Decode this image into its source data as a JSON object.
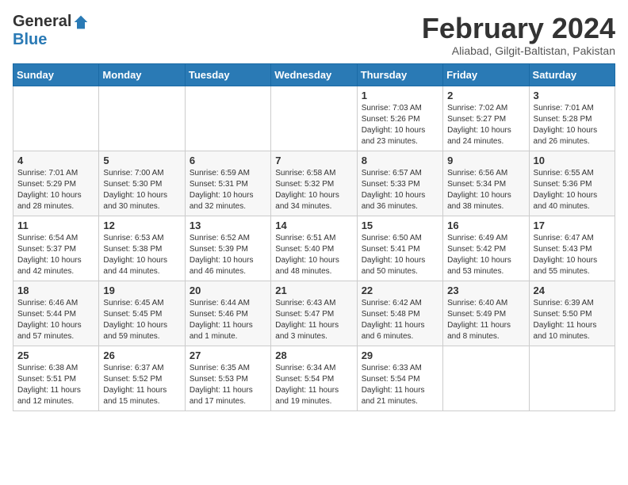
{
  "header": {
    "logo_general": "General",
    "logo_blue": "Blue",
    "month_year": "February 2024",
    "location": "Aliabad, Gilgit-Baltistan, Pakistan"
  },
  "days_of_week": [
    "Sunday",
    "Monday",
    "Tuesday",
    "Wednesday",
    "Thursday",
    "Friday",
    "Saturday"
  ],
  "weeks": [
    [
      {
        "day": "",
        "info": ""
      },
      {
        "day": "",
        "info": ""
      },
      {
        "day": "",
        "info": ""
      },
      {
        "day": "",
        "info": ""
      },
      {
        "day": "1",
        "info": "Sunrise: 7:03 AM\nSunset: 5:26 PM\nDaylight: 10 hours and 23 minutes."
      },
      {
        "day": "2",
        "info": "Sunrise: 7:02 AM\nSunset: 5:27 PM\nDaylight: 10 hours and 24 minutes."
      },
      {
        "day": "3",
        "info": "Sunrise: 7:01 AM\nSunset: 5:28 PM\nDaylight: 10 hours and 26 minutes."
      }
    ],
    [
      {
        "day": "4",
        "info": "Sunrise: 7:01 AM\nSunset: 5:29 PM\nDaylight: 10 hours and 28 minutes."
      },
      {
        "day": "5",
        "info": "Sunrise: 7:00 AM\nSunset: 5:30 PM\nDaylight: 10 hours and 30 minutes."
      },
      {
        "day": "6",
        "info": "Sunrise: 6:59 AM\nSunset: 5:31 PM\nDaylight: 10 hours and 32 minutes."
      },
      {
        "day": "7",
        "info": "Sunrise: 6:58 AM\nSunset: 5:32 PM\nDaylight: 10 hours and 34 minutes."
      },
      {
        "day": "8",
        "info": "Sunrise: 6:57 AM\nSunset: 5:33 PM\nDaylight: 10 hours and 36 minutes."
      },
      {
        "day": "9",
        "info": "Sunrise: 6:56 AM\nSunset: 5:34 PM\nDaylight: 10 hours and 38 minutes."
      },
      {
        "day": "10",
        "info": "Sunrise: 6:55 AM\nSunset: 5:36 PM\nDaylight: 10 hours and 40 minutes."
      }
    ],
    [
      {
        "day": "11",
        "info": "Sunrise: 6:54 AM\nSunset: 5:37 PM\nDaylight: 10 hours and 42 minutes."
      },
      {
        "day": "12",
        "info": "Sunrise: 6:53 AM\nSunset: 5:38 PM\nDaylight: 10 hours and 44 minutes."
      },
      {
        "day": "13",
        "info": "Sunrise: 6:52 AM\nSunset: 5:39 PM\nDaylight: 10 hours and 46 minutes."
      },
      {
        "day": "14",
        "info": "Sunrise: 6:51 AM\nSunset: 5:40 PM\nDaylight: 10 hours and 48 minutes."
      },
      {
        "day": "15",
        "info": "Sunrise: 6:50 AM\nSunset: 5:41 PM\nDaylight: 10 hours and 50 minutes."
      },
      {
        "day": "16",
        "info": "Sunrise: 6:49 AM\nSunset: 5:42 PM\nDaylight: 10 hours and 53 minutes."
      },
      {
        "day": "17",
        "info": "Sunrise: 6:47 AM\nSunset: 5:43 PM\nDaylight: 10 hours and 55 minutes."
      }
    ],
    [
      {
        "day": "18",
        "info": "Sunrise: 6:46 AM\nSunset: 5:44 PM\nDaylight: 10 hours and 57 minutes."
      },
      {
        "day": "19",
        "info": "Sunrise: 6:45 AM\nSunset: 5:45 PM\nDaylight: 10 hours and 59 minutes."
      },
      {
        "day": "20",
        "info": "Sunrise: 6:44 AM\nSunset: 5:46 PM\nDaylight: 11 hours and 1 minute."
      },
      {
        "day": "21",
        "info": "Sunrise: 6:43 AM\nSunset: 5:47 PM\nDaylight: 11 hours and 3 minutes."
      },
      {
        "day": "22",
        "info": "Sunrise: 6:42 AM\nSunset: 5:48 PM\nDaylight: 11 hours and 6 minutes."
      },
      {
        "day": "23",
        "info": "Sunrise: 6:40 AM\nSunset: 5:49 PM\nDaylight: 11 hours and 8 minutes."
      },
      {
        "day": "24",
        "info": "Sunrise: 6:39 AM\nSunset: 5:50 PM\nDaylight: 11 hours and 10 minutes."
      }
    ],
    [
      {
        "day": "25",
        "info": "Sunrise: 6:38 AM\nSunset: 5:51 PM\nDaylight: 11 hours and 12 minutes."
      },
      {
        "day": "26",
        "info": "Sunrise: 6:37 AM\nSunset: 5:52 PM\nDaylight: 11 hours and 15 minutes."
      },
      {
        "day": "27",
        "info": "Sunrise: 6:35 AM\nSunset: 5:53 PM\nDaylight: 11 hours and 17 minutes."
      },
      {
        "day": "28",
        "info": "Sunrise: 6:34 AM\nSunset: 5:54 PM\nDaylight: 11 hours and 19 minutes."
      },
      {
        "day": "29",
        "info": "Sunrise: 6:33 AM\nSunset: 5:54 PM\nDaylight: 11 hours and 21 minutes."
      },
      {
        "day": "",
        "info": ""
      },
      {
        "day": "",
        "info": ""
      }
    ]
  ]
}
